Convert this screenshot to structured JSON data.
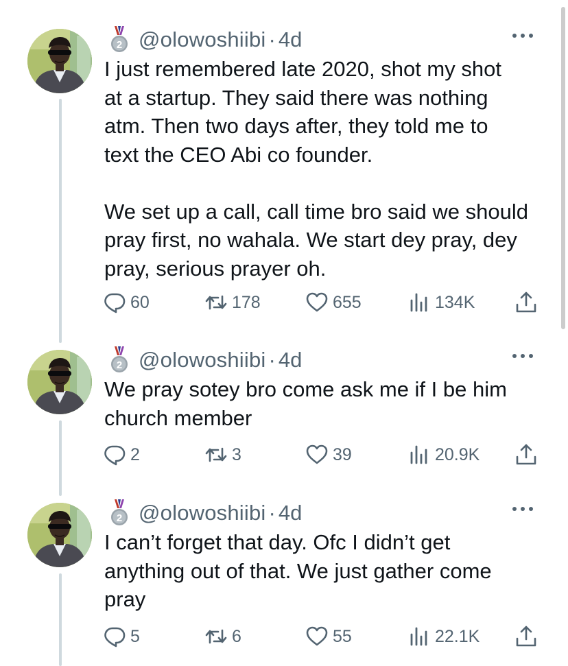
{
  "tweets": [
    {
      "handle": "@olowoshiibi",
      "separator": "·",
      "time": "4d",
      "text": "I just remembered late 2020, shot my shot\nat a startup. They said there was nothing\natm. Then two days after, they told me to\ntext the CEO Abi co founder.\n\nWe set up a call, call time bro said we should\npray first, no wahala. We start dey pray, dey\npray, serious prayer oh.",
      "replies": "60",
      "reposts": "178",
      "likes": "655",
      "views": "134K"
    },
    {
      "handle": "@olowoshiibi",
      "separator": "·",
      "time": "4d",
      "text": "We pray sotey bro come ask me if I be him\nchurch member",
      "replies": "2",
      "reposts": "3",
      "likes": "39",
      "views": "20.9K"
    },
    {
      "handle": "@olowoshiibi",
      "separator": "·",
      "time": "4d",
      "text": "I can’t forget that day. Ofc I didn’t get\nanything out of that. We just gather come\npray",
      "replies": "5",
      "reposts": "6",
      "likes": "55",
      "views": "22.1K"
    }
  ],
  "icons": {
    "badge": "silver-medal-2-icon",
    "more": "more-dots-icon",
    "reply": "reply-icon",
    "repost": "repost-icon",
    "like": "heart-icon",
    "views": "views-chart-icon",
    "share": "share-icon"
  },
  "colors": {
    "text": "#0f1419",
    "muted": "#536471",
    "thread_line": "#cfd9de"
  }
}
